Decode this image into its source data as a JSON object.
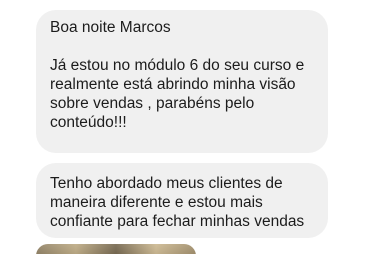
{
  "messages": [
    {
      "greeting": "Boa noite Marcos",
      "body": "Já estou no módulo 6 do seu curso e realmente está abrindo minha visão sobre vendas , parabéns pelo conteúdo!!!"
    },
    {
      "body": "Tenho abordado meus clientes de maneira diferente e estou mais confiante para fechar minhas vendas"
    }
  ],
  "colors": {
    "bubble_background": "#f0f0f0",
    "text": "#1c1c1c",
    "page_background": "#ffffff"
  }
}
